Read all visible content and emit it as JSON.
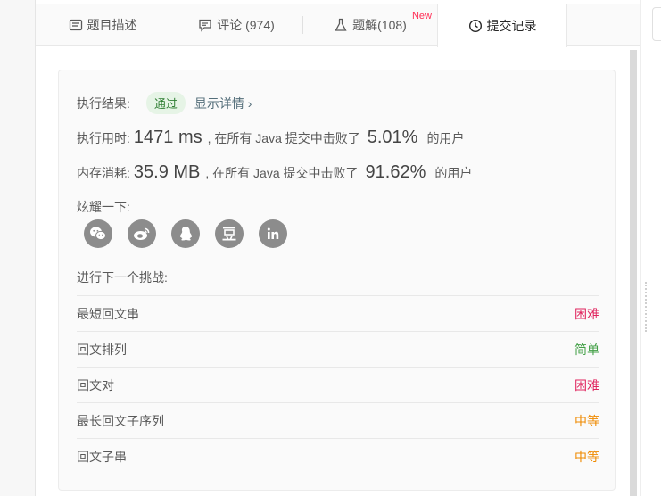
{
  "tabs": [
    {
      "label": "题目描述",
      "icon": "description-icon"
    },
    {
      "label": "评论 (974)",
      "icon": "comment-icon"
    },
    {
      "label": "题解(108)",
      "icon": "flask-icon",
      "badge": "New"
    },
    {
      "label": "提交记录",
      "icon": "clock-icon"
    }
  ],
  "result": {
    "label": "执行结果:",
    "status": "通过",
    "detail_link": "显示详情 ›"
  },
  "runtime": {
    "label": "执行用时:",
    "value": "1471 ms",
    "mid": ", 在所有 Java 提交中击败了",
    "percent": "5.01%",
    "suffix": "的用户"
  },
  "memory": {
    "label": "内存消耗:",
    "value": "35.9 MB",
    "mid": ", 在所有 Java 提交中击败了",
    "percent": "91.62%",
    "suffix": "的用户"
  },
  "share": {
    "label": "炫耀一下:",
    "icons": [
      "wechat-icon",
      "weibo-icon",
      "qq-icon",
      "douban-icon",
      "linkedin-icon"
    ]
  },
  "next": {
    "label": "进行下一个挑战:",
    "problems": [
      {
        "title": "最短回文串",
        "difficulty": "困难",
        "level": "hard"
      },
      {
        "title": "回文排列",
        "difficulty": "简单",
        "level": "easy"
      },
      {
        "title": "回文对",
        "difficulty": "困难",
        "level": "hard"
      },
      {
        "title": "最长回文子序列",
        "difficulty": "中等",
        "level": "medium"
      },
      {
        "title": "回文子串",
        "difficulty": "中等",
        "level": "medium"
      }
    ]
  },
  "colors": {
    "hard": "#e0245e",
    "easy": "#43a047",
    "medium": "#ef8a00",
    "pass_bg": "#e6f4e6",
    "pass_text": "#2e7d32"
  }
}
